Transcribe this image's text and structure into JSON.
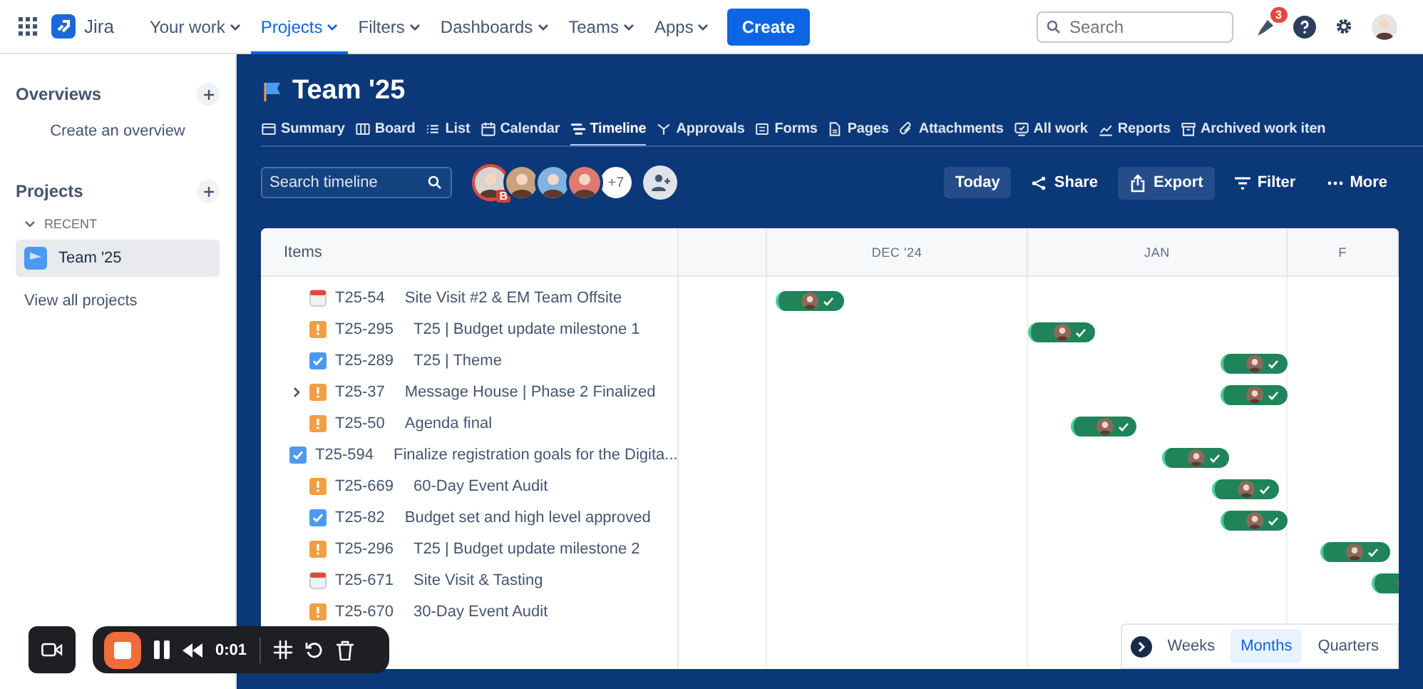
{
  "top_nav": {
    "product": "Jira",
    "menus": [
      {
        "label": "Your work",
        "selected": false
      },
      {
        "label": "Projects",
        "selected": true
      },
      {
        "label": "Filters",
        "selected": false
      },
      {
        "label": "Dashboards",
        "selected": false
      },
      {
        "label": "Teams",
        "selected": false
      },
      {
        "label": "Apps",
        "selected": false
      }
    ],
    "create_button": "Create",
    "search": {
      "placeholder": "Search"
    },
    "notification_count": "3"
  },
  "sidebar": {
    "overviews": {
      "title": "Overviews",
      "link": "Create an overview"
    },
    "projects": {
      "title": "Projects",
      "section": "RECENT",
      "expanded": true,
      "items": [
        {
          "label": "Team '25",
          "selected": true
        }
      ],
      "link": "View all projects"
    }
  },
  "project": {
    "title": "Team '25",
    "tabs": [
      {
        "label": "Summary",
        "selected": false
      },
      {
        "label": "Board",
        "selected": false
      },
      {
        "label": "List",
        "selected": false
      },
      {
        "label": "Calendar",
        "selected": false
      },
      {
        "label": "Timeline",
        "selected": true
      },
      {
        "label": "Approvals",
        "selected": false
      },
      {
        "label": "Forms",
        "selected": false
      },
      {
        "label": "Pages",
        "selected": false
      },
      {
        "label": "Attachments",
        "selected": false
      },
      {
        "label": "All work",
        "selected": false
      },
      {
        "label": "Reports",
        "selected": false
      },
      {
        "label": "Archived work iten",
        "selected": false
      }
    ]
  },
  "toolbar": {
    "search": {
      "placeholder": "Search timeline"
    },
    "avatar_badge": "B",
    "more_people": "+7",
    "actions": [
      "Today",
      "Share",
      "Export",
      "Filter",
      "More"
    ]
  },
  "timeline": {
    "items_header": "Items",
    "months": [
      "DEC '24",
      "JAN",
      "F"
    ],
    "rows": [
      {
        "kind": "event",
        "key": "T25-54",
        "summary": "Site Visit #2 & EM Team Offsite"
      },
      {
        "kind": "milestone",
        "key": "T25-295",
        "summary": "T25 | Budget update milestone 1"
      },
      {
        "kind": "task",
        "key": "T25-289",
        "summary": "T25 | Theme"
      },
      {
        "kind": "milestone",
        "key": "T25-37",
        "summary": "Message House | Phase 2 Finalized",
        "expanded": false
      },
      {
        "kind": "milestone",
        "key": "T25-50",
        "summary": "Agenda final"
      },
      {
        "kind": "task",
        "key": "T25-594",
        "summary": "Finalize registration goals for the Digita..."
      },
      {
        "kind": "milestone",
        "key": "T25-669",
        "summary": "60-Day Event Audit"
      },
      {
        "kind": "task",
        "key": "T25-82",
        "summary": "Budget set and high level approved"
      },
      {
        "kind": "milestone",
        "key": "T25-296",
        "summary": "T25 | Budget update milestone 2"
      },
      {
        "kind": "event",
        "key": "T25-671",
        "summary": "Site Visit & Tasting"
      },
      {
        "kind": "milestone",
        "key": "T25-670",
        "summary": "30-Day Event Audit"
      }
    ],
    "scales": [
      {
        "label": "Weeks",
        "selected": false
      },
      {
        "label": "Months",
        "selected": true
      },
      {
        "label": "Quarters",
        "selected": false
      }
    ]
  },
  "recorder": {
    "time": "0:01"
  }
}
